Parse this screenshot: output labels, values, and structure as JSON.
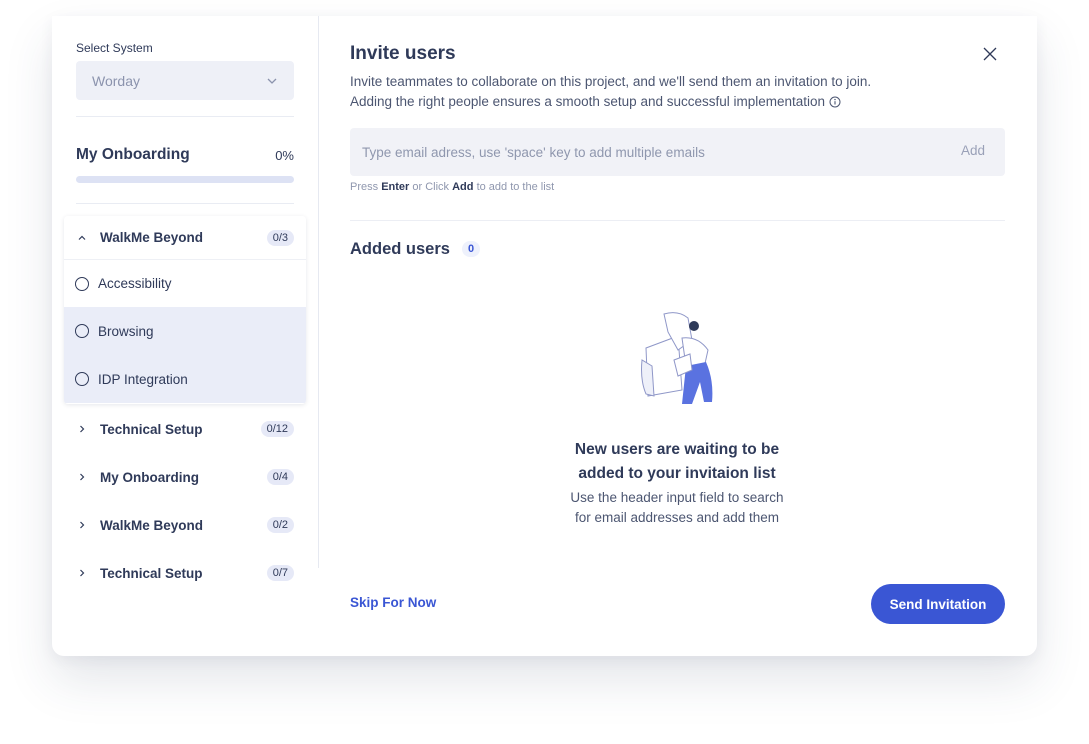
{
  "sidebar": {
    "system_label": "Select System",
    "system_value": "Worday",
    "onboarding_title": "My Onboarding",
    "onboarding_progress_text": "0%",
    "onboarding_progress_fraction": 0,
    "open_group": {
      "name": "WalkMe Beyond",
      "count": "0/3",
      "tasks": [
        "Accessibility",
        "Browsing",
        "IDP Integration"
      ]
    },
    "groups": [
      {
        "name": "Technical Setup",
        "count": "0/12"
      },
      {
        "name": "My Onboarding",
        "count": "0/4"
      },
      {
        "name": "WalkMe Beyond",
        "count": "0/2"
      },
      {
        "name": "Technical Setup",
        "count": "0/7"
      }
    ]
  },
  "main": {
    "title": "Invite users",
    "description_line1": "Invite teammates to collaborate on this project, and we'll send them an invitation to join.",
    "description_line2": "Adding the right people ensures a smooth setup and successful implementation",
    "email_placeholder": "Type email adress, use 'space' key to add multiple emails",
    "email_value": "",
    "add_label": "Add",
    "hint_press": "Press",
    "hint_enter": "Enter",
    "hint_or_click": "or Click",
    "hint_add": "Add",
    "hint_tail": "to add to the list",
    "added_title": "Added users",
    "added_count": "0",
    "empty_title_line1": "New users are waiting to be",
    "empty_title_line2": "added to your invitaion list",
    "empty_sub_line1": "Use the header input field to search",
    "empty_sub_line2": "for email addresses and add them",
    "skip_label": "Skip For Now",
    "send_label": "Send Invitation"
  },
  "icons": {
    "close": "close-icon",
    "dropdown": "chevron-down-icon",
    "info": "info-icon",
    "group_open": "chevron-up-icon",
    "group_closed": "chevron-right-icon"
  },
  "colors": {
    "accent": "#3a56d4",
    "text": "#2f3a59",
    "progress_track": "#dde2f4",
    "task_highlight": "#eaedf8"
  }
}
